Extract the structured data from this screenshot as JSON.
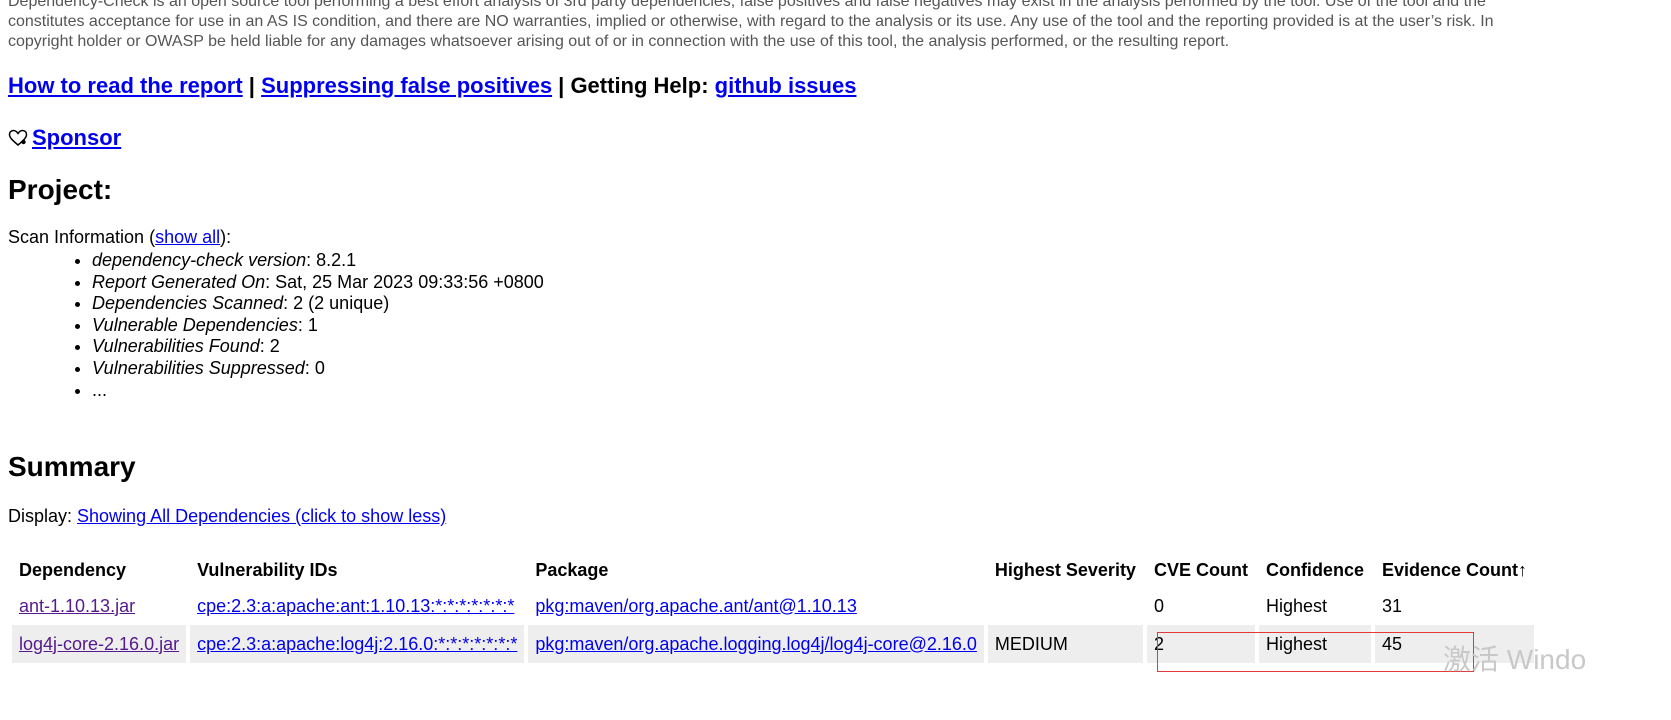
{
  "disclaimer": {
    "line1": "Dependency-Check is an open source tool performing a best effort analysis of 3rd party dependencies; false positives and false negatives may exist in the analysis performed by the tool. Use of the tool and the",
    "line2": "constitutes acceptance for use in an AS IS condition, and there are NO warranties, implied or otherwise, with regard to the analysis or its use. Any use of the tool and the reporting provided is at the user’s risk. In",
    "line3": "copyright holder or OWASP be held liable for any damages whatsoever arising out of or in connection with the use of this tool, the analysis performed, or the resulting report."
  },
  "help": {
    "read_report": "How to read the report",
    "sep1": " | ",
    "suppressing": "Suppressing false positives",
    "sep2": " | Getting Help: ",
    "github": "github issues"
  },
  "sponsor": {
    "icon": "heart-icon",
    "label": "Sponsor"
  },
  "project": {
    "heading": "Project:"
  },
  "scan": {
    "label": "Scan Information (",
    "show_all": "show all",
    "label_end": "):",
    "items": [
      {
        "key": "dependency-check version",
        "value": ": 8.2.1"
      },
      {
        "key": "Report Generated On",
        "value": ": Sat, 25 Mar 2023 09:33:56 +0800"
      },
      {
        "key": "Dependencies Scanned",
        "value": ": 2 (2 unique)"
      },
      {
        "key": "Vulnerable Dependencies",
        "value": ": 1"
      },
      {
        "key": "Vulnerabilities Found",
        "value": ": 2"
      },
      {
        "key": "Vulnerabilities Suppressed",
        "value": ": 0"
      },
      {
        "key": "",
        "value": "..."
      }
    ]
  },
  "summary": {
    "heading": "Summary",
    "display_label": "Display: ",
    "display_link": "Showing All Dependencies (click to show less)",
    "columns": [
      "Dependency",
      "Vulnerability IDs",
      "Package",
      "Highest Severity",
      "CVE Count",
      "Confidence",
      "Evidence Count↑"
    ],
    "rows": [
      {
        "dependency": "ant-1.10.13.jar",
        "vuln_ids": "cpe:2.3:a:apache:ant:1.10.13:*:*:*:*:*:*:*",
        "package": "pkg:maven/org.apache.ant/ant@1.10.13",
        "severity": "",
        "cve_count": "0",
        "confidence": "Highest",
        "evidence": "31"
      },
      {
        "dependency": "log4j-core-2.16.0.jar",
        "vuln_ids": "cpe:2.3:a:apache:log4j:2.16.0:*:*:*:*:*:*:*",
        "package": "pkg:maven/org.apache.logging.log4j/log4j-core@2.16.0",
        "severity": "MEDIUM",
        "cve_count": "2",
        "confidence": "Highest",
        "evidence": "45"
      }
    ]
  },
  "watermark": "激活 Windo"
}
